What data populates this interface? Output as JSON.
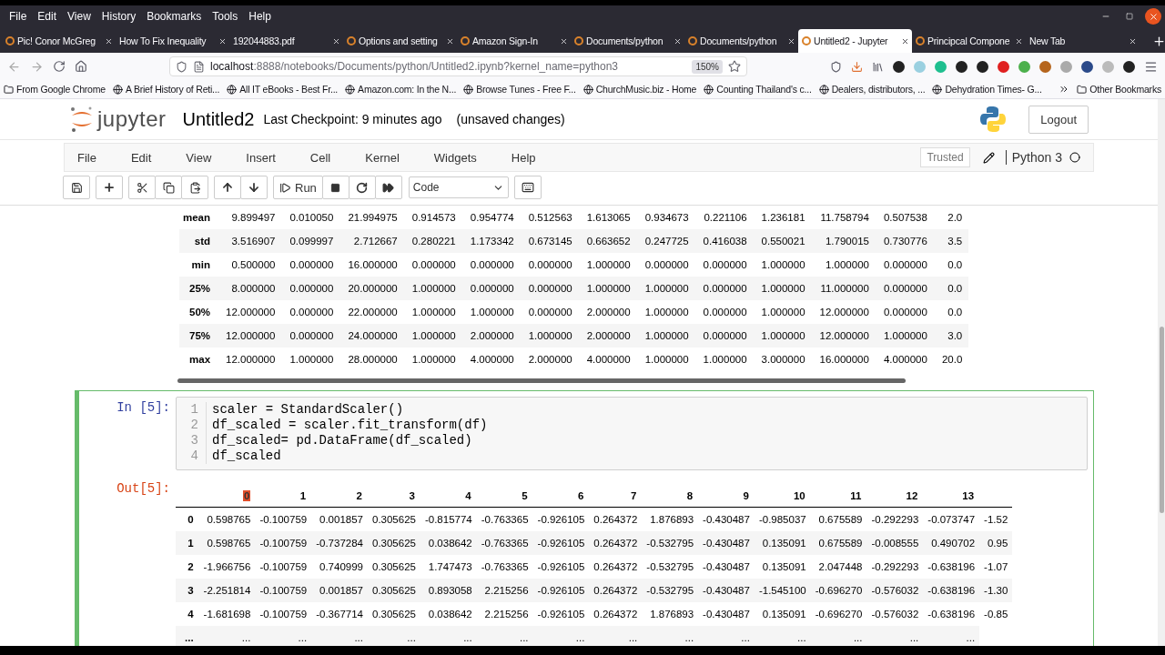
{
  "browser": {
    "menu": [
      "File",
      "Edit",
      "View",
      "History",
      "Bookmarks",
      "Tools",
      "Help"
    ],
    "tabs": [
      {
        "label": "Pic! Conor McGreg",
        "selected": false,
        "has_icon": true
      },
      {
        "label": "How To Fix Inequality",
        "selected": false,
        "has_icon": false
      },
      {
        "label": "192044883.pdf",
        "selected": false,
        "has_icon": false
      },
      {
        "label": "Options and setting",
        "selected": false,
        "has_icon": true
      },
      {
        "label": "Amazon Sign-In",
        "selected": false,
        "has_icon": true
      },
      {
        "label": "Documents/python",
        "selected": false,
        "has_icon": true
      },
      {
        "label": "Documents/python",
        "selected": false,
        "has_icon": true
      },
      {
        "label": "Untitled2 - Jupyter",
        "selected": true,
        "has_icon": true
      },
      {
        "label": "Principcal Compone",
        "selected": false,
        "has_icon": true
      },
      {
        "label": "New Tab",
        "selected": false,
        "has_icon": false
      }
    ],
    "url_host": "localhost",
    "url_rest": ":8888/notebooks/Documents/python/Untitled2.ipynb?kernel_name=python3",
    "zoom": "150%",
    "bookmarks": [
      {
        "label": "From Google Chrome",
        "kind": "folder"
      },
      {
        "label": "A Brief History of Reti...",
        "kind": "site"
      },
      {
        "label": "All IT eBooks - Best Fr...",
        "kind": "site"
      },
      {
        "label": "Amazon.com: In the N...",
        "kind": "site"
      },
      {
        "label": "Browse Tunes - Free F...",
        "kind": "site"
      },
      {
        "label": "ChurchMusic.biz - Home",
        "kind": "site"
      },
      {
        "label": "Counting Thailand's c...",
        "kind": "site"
      },
      {
        "label": "Dealers, distributors, ...",
        "kind": "site"
      },
      {
        "label": "Dehydration Times- G...",
        "kind": "site"
      }
    ],
    "other_bookmarks": "Other Bookmarks"
  },
  "jupyter": {
    "logo_text": "jupyter",
    "title": "Untitled2",
    "checkpoint": "Last Checkpoint: 9 minutes ago",
    "save_status": "(unsaved changes)",
    "logout": "Logout",
    "menu": [
      "File",
      "Edit",
      "View",
      "Insert",
      "Cell",
      "Kernel",
      "Widgets",
      "Help"
    ],
    "trusted": "Trusted",
    "kernel": "Python 3",
    "run": "Run",
    "cell_type": "Code"
  },
  "describe_table": {
    "rows": [
      {
        "label": "mean",
        "values": [
          "9.899497",
          "0.010050",
          "21.994975",
          "0.914573",
          "0.954774",
          "0.512563",
          "1.613065",
          "0.934673",
          "0.221106",
          "1.236181",
          "11.758794",
          "0.507538",
          "2.0"
        ]
      },
      {
        "label": "std",
        "values": [
          "3.516907",
          "0.099997",
          "2.712667",
          "0.280221",
          "1.173342",
          "0.673145",
          "0.663652",
          "0.247725",
          "0.416038",
          "0.550021",
          "1.790015",
          "0.730776",
          "3.5"
        ]
      },
      {
        "label": "min",
        "values": [
          "0.500000",
          "0.000000",
          "16.000000",
          "0.000000",
          "0.000000",
          "0.000000",
          "1.000000",
          "0.000000",
          "0.000000",
          "1.000000",
          "1.000000",
          "0.000000",
          "0.0"
        ]
      },
      {
        "label": "25%",
        "values": [
          "8.000000",
          "0.000000",
          "20.000000",
          "1.000000",
          "0.000000",
          "0.000000",
          "1.000000",
          "1.000000",
          "0.000000",
          "1.000000",
          "11.000000",
          "0.000000",
          "0.0"
        ]
      },
      {
        "label": "50%",
        "values": [
          "12.000000",
          "0.000000",
          "22.000000",
          "1.000000",
          "1.000000",
          "0.000000",
          "2.000000",
          "1.000000",
          "0.000000",
          "1.000000",
          "12.000000",
          "0.000000",
          "0.0"
        ]
      },
      {
        "label": "75%",
        "values": [
          "12.000000",
          "0.000000",
          "24.000000",
          "1.000000",
          "2.000000",
          "1.000000",
          "2.000000",
          "1.000000",
          "0.000000",
          "1.000000",
          "12.000000",
          "1.000000",
          "3.0"
        ]
      },
      {
        "label": "max",
        "values": [
          "12.000000",
          "1.000000",
          "28.000000",
          "1.000000",
          "4.000000",
          "2.000000",
          "4.000000",
          "1.000000",
          "1.000000",
          "3.000000",
          "16.000000",
          "4.000000",
          "20.0"
        ]
      }
    ]
  },
  "cell": {
    "in_prompt": "In [5]:",
    "selected": true,
    "code_lines": [
      {
        "number": "1",
        "code": "scaler = StandardScaler()"
      },
      {
        "number": "2",
        "code": "df_scaled = scaler.fit_transform(df)"
      },
      {
        "number": "3",
        "code": "df_scaled= pd.DataFrame(df_scaled)"
      },
      {
        "number": "4",
        "code": "df_scaled"
      }
    ],
    "out_prompt": "Out[5]:",
    "output_table": {
      "columns": [
        {
          "label": "0",
          "highlighted": true
        },
        {
          "label": "1",
          "highlighted": false
        },
        {
          "label": "2",
          "highlighted": false
        },
        {
          "label": "3",
          "highlighted": false
        },
        {
          "label": "4",
          "highlighted": false
        },
        {
          "label": "5",
          "highlighted": false
        },
        {
          "label": "6",
          "highlighted": false
        },
        {
          "label": "7",
          "highlighted": false
        },
        {
          "label": "8",
          "highlighted": false
        },
        {
          "label": "9",
          "highlighted": false
        },
        {
          "label": "10",
          "highlighted": false
        },
        {
          "label": "11",
          "highlighted": false
        },
        {
          "label": "12",
          "highlighted": false
        },
        {
          "label": "13",
          "highlighted": false
        }
      ],
      "rows": [
        {
          "index": "0",
          "values": [
            "0.598765",
            "-0.100759",
            "0.001857",
            "0.305625",
            "-0.815774",
            "-0.763365",
            "-0.926105",
            "0.264372",
            "1.876893",
            "-0.430487",
            "-0.985037",
            "0.675589",
            "-0.292293",
            "-0.073747",
            "-1.52"
          ]
        },
        {
          "index": "1",
          "values": [
            "0.598765",
            "-0.100759",
            "-0.737284",
            "0.305625",
            "0.038642",
            "-0.763365",
            "-0.926105",
            "0.264372",
            "-0.532795",
            "-0.430487",
            "0.135091",
            "0.675589",
            "-0.008555",
            "0.490702",
            "0.95"
          ]
        },
        {
          "index": "2",
          "values": [
            "-1.966756",
            "-0.100759",
            "0.740999",
            "0.305625",
            "1.747473",
            "-0.763365",
            "-0.926105",
            "0.264372",
            "-0.532795",
            "-0.430487",
            "0.135091",
            "2.047448",
            "-0.292293",
            "-0.638196",
            "-1.07"
          ]
        },
        {
          "index": "3",
          "values": [
            "-2.251814",
            "-0.100759",
            "0.001857",
            "0.305625",
            "0.893058",
            "2.215256",
            "-0.926105",
            "0.264372",
            "-0.532795",
            "-0.430487",
            "-1.545100",
            "-0.696270",
            "-0.576032",
            "-0.638196",
            "-1.30"
          ]
        },
        {
          "index": "4",
          "values": [
            "-1.681698",
            "-0.100759",
            "-0.367714",
            "0.305625",
            "0.038642",
            "2.215256",
            "-0.926105",
            "0.264372",
            "1.876893",
            "-0.430487",
            "0.135091",
            "-0.696270",
            "-0.576032",
            "-0.638196",
            "-0.85"
          ]
        },
        {
          "index": "...",
          "values": [
            "...",
            "...",
            "...",
            "...",
            "...",
            "...",
            "...",
            "...",
            "...",
            "...",
            "...",
            "...",
            "...",
            "..."
          ]
        }
      ]
    }
  }
}
